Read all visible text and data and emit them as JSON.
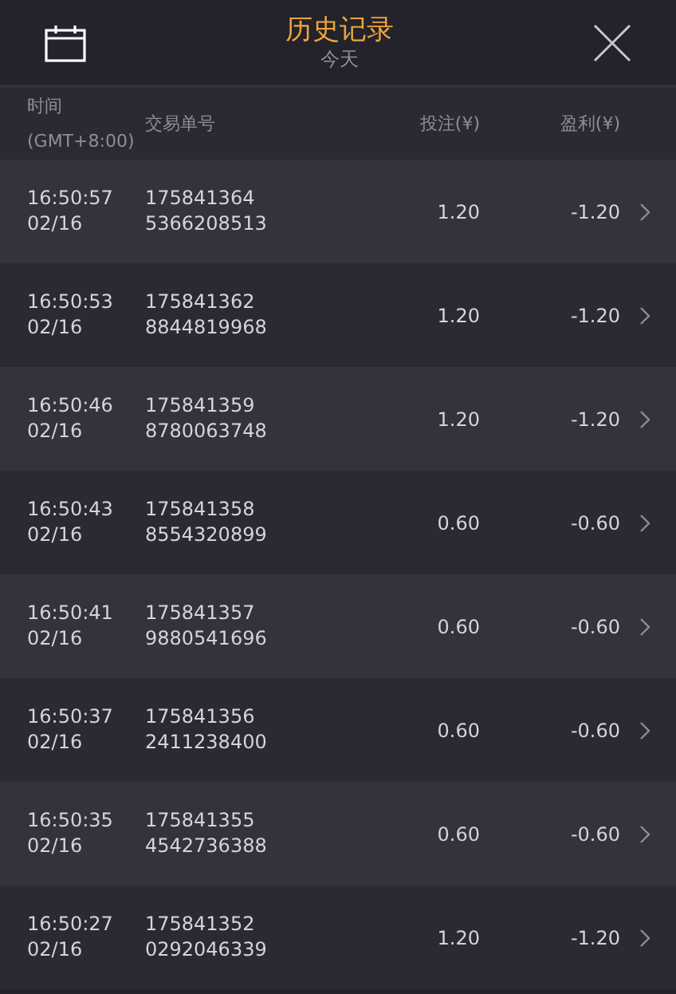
{
  "header": {
    "title": "历史记录",
    "subtitle": "今天"
  },
  "table": {
    "columns": [
      {
        "line1": "时间",
        "line2": "(GMT+8:00)"
      },
      {
        "line1": "交易单号"
      },
      {
        "line1": "投注(¥)"
      },
      {
        "line1": "盈利(¥)"
      }
    ],
    "rows": [
      {
        "time": "16:50:57",
        "date": "02/16",
        "order_line1": "175841364",
        "order_line2": "5366208513",
        "bet": "1.20",
        "profit": "-1.20"
      },
      {
        "time": "16:50:53",
        "date": "02/16",
        "order_line1": "175841362",
        "order_line2": "8844819968",
        "bet": "1.20",
        "profit": "-1.20"
      },
      {
        "time": "16:50:46",
        "date": "02/16",
        "order_line1": "175841359",
        "order_line2": "8780063748",
        "bet": "1.20",
        "profit": "-1.20"
      },
      {
        "time": "16:50:43",
        "date": "02/16",
        "order_line1": "175841358",
        "order_line2": "8554320899",
        "bet": "0.60",
        "profit": "-0.60"
      },
      {
        "time": "16:50:41",
        "date": "02/16",
        "order_line1": "175841357",
        "order_line2": "9880541696",
        "bet": "0.60",
        "profit": "-0.60"
      },
      {
        "time": "16:50:37",
        "date": "02/16",
        "order_line1": "175841356",
        "order_line2": "2411238400",
        "bet": "0.60",
        "profit": "-0.60"
      },
      {
        "time": "16:50:35",
        "date": "02/16",
        "order_line1": "175841355",
        "order_line2": "4542736388",
        "bet": "0.60",
        "profit": "-0.60"
      },
      {
        "time": "16:50:27",
        "date": "02/16",
        "order_line1": "175841352",
        "order_line2": "0292046339",
        "bet": "1.20",
        "profit": "-1.20"
      }
    ]
  }
}
